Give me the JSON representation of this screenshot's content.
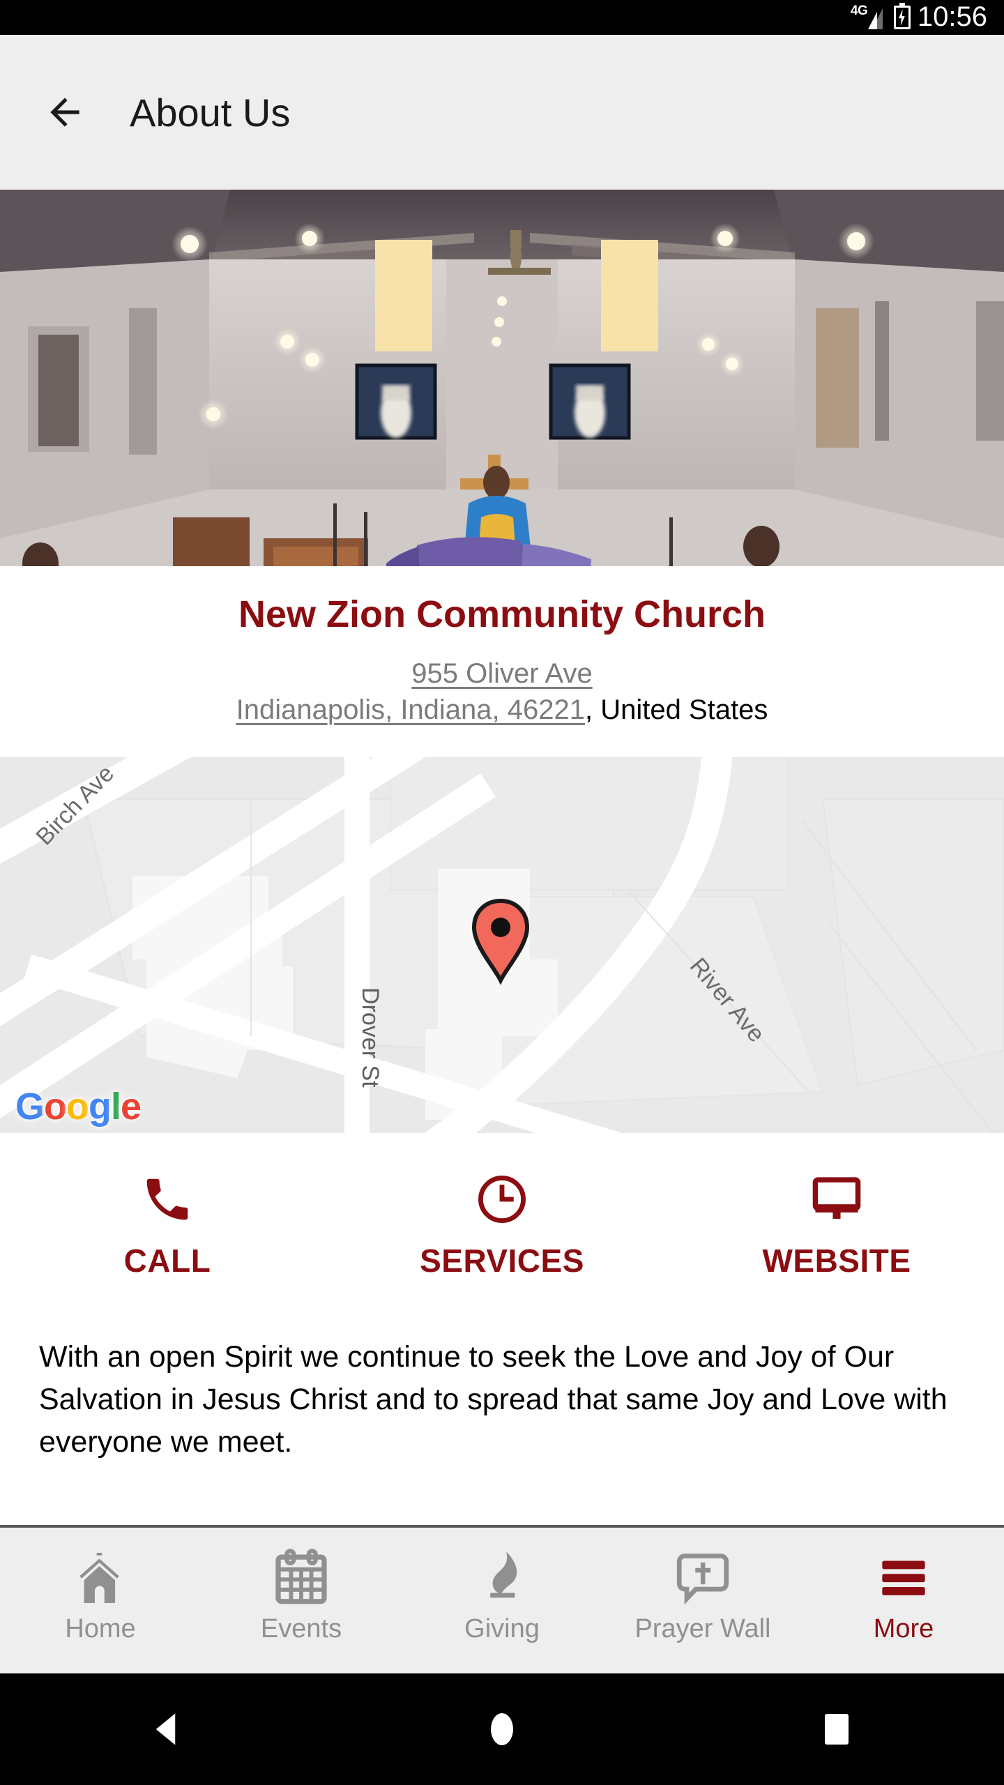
{
  "status_bar": {
    "network": "4G",
    "time": "10:56",
    "battery_icon": "battery-charging-icon",
    "signal_icon": "signal-bars-icon"
  },
  "app_bar": {
    "back_icon": "back-arrow-icon",
    "title": "About Us"
  },
  "hero": {
    "alt": "church-sanctuary-congregation-photo"
  },
  "info": {
    "church_name": "New Zion Community Church",
    "address_line1": "955 Oliver Ave",
    "address_line2": "Indianapolis, Indiana, 46221",
    "country": ", United States",
    "name_color": "#8b0d11",
    "link_color": "#7b7b7b"
  },
  "map": {
    "attribution": "Google",
    "google_letters": [
      "G",
      "o",
      "o",
      "g",
      "l",
      "e"
    ],
    "streets": [
      {
        "name": "Birch Ave"
      },
      {
        "name": "Drover St"
      },
      {
        "name": "River Ave"
      }
    ],
    "marker_icon": "map-pin-icon",
    "marker_color": "#f2695c"
  },
  "actions": [
    {
      "label": "CALL",
      "icon": "phone-icon"
    },
    {
      "label": "SERVICES",
      "icon": "clock-icon"
    },
    {
      "label": "WEBSITE",
      "icon": "monitor-icon"
    }
  ],
  "description": {
    "text": "With an open Spirit we continue to seek the Love and Joy of Our Salvation in Jesus Christ and to spread that same Joy and Love with everyone we meet."
  },
  "bottom_nav": {
    "active_color": "#8b0d11",
    "inactive_color": "#909090",
    "items": [
      {
        "label": "Home",
        "icon": "church-icon",
        "active": false
      },
      {
        "label": "Events",
        "icon": "calendar-icon",
        "active": false
      },
      {
        "label": "Giving",
        "icon": "flame-candle-icon",
        "active": false
      },
      {
        "label": "Prayer Wall",
        "icon": "speech-bubble-cross-icon",
        "active": false
      },
      {
        "label": "More",
        "icon": "hamburger-menu-icon",
        "active": true
      }
    ]
  },
  "system_nav": {
    "back_icon": "system-back-triangle-icon",
    "home_icon": "system-home-circle-icon",
    "recents_icon": "system-recents-square-icon"
  }
}
